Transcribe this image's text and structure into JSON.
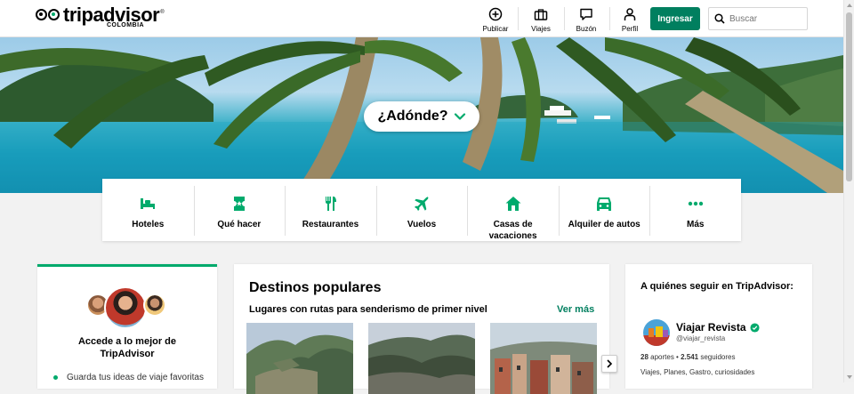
{
  "header": {
    "logo_text": "tripadvisor",
    "logo_country": "COLOMBIA",
    "nav": [
      {
        "label": "Publicar",
        "icon": "plus-circle-icon"
      },
      {
        "label": "Viajes",
        "icon": "suitcase-icon"
      },
      {
        "label": "Buzón",
        "icon": "message-icon"
      },
      {
        "label": "Perfil",
        "icon": "person-icon"
      }
    ],
    "login_label": "Ingresar",
    "search_placeholder": "Buscar"
  },
  "hero": {
    "where_label": "¿Adónde?"
  },
  "categories": [
    {
      "label": "Hoteles",
      "icon": "bed-icon"
    },
    {
      "label": "Qué hacer",
      "icon": "ticket-icon"
    },
    {
      "label": "Restaurantes",
      "icon": "fork-knife-icon"
    },
    {
      "label": "Vuelos",
      "icon": "plane-icon"
    },
    {
      "label": "Casas de vacaciones",
      "icon": "house-icon"
    },
    {
      "label": "Alquiler de autos",
      "icon": "car-icon"
    },
    {
      "label": "Más",
      "icon": "more-dots-icon"
    }
  ],
  "access_card": {
    "title": "Accede a lo mejor de TripAdvisor",
    "items": [
      "Guarda tus ideas de viaje favoritas"
    ]
  },
  "destinations": {
    "title": "Destinos populares",
    "subtitle": "Lugares con rutas para senderismo de primer nivel",
    "see_more": "Ver más"
  },
  "follow": {
    "title": "A quiénes seguir en TripAdvisor:",
    "name": "Viajar Revista",
    "handle": "@viajar_revista",
    "contributions": "28",
    "contributions_label": "aportes",
    "followers": "2.541",
    "followers_label": "seguidores",
    "tags": "Viajes, Planes, Gastro, curiosidades"
  },
  "colors": {
    "brand_green": "#00aa6c",
    "button_green": "#007f5f"
  }
}
